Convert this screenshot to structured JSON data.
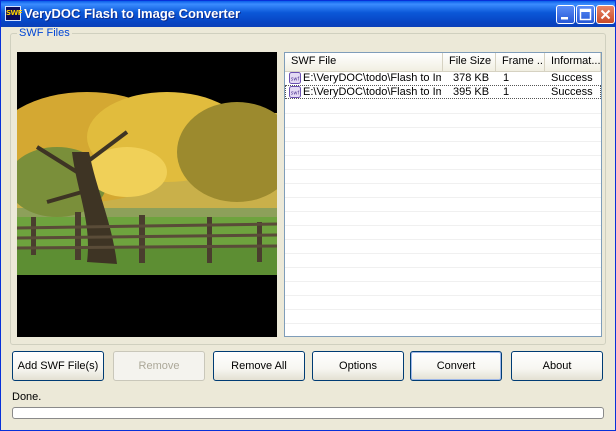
{
  "window": {
    "title": "VeryDOC Flash to Image Converter",
    "icon_text": "SWF",
    "icon": "swf-app-icon",
    "controls": [
      "minimize-icon",
      "maximize-icon",
      "close-icon"
    ]
  },
  "group": {
    "label": "SWF Files"
  },
  "preview": {
    "description_icon": "autumn-tree-image"
  },
  "list": {
    "columns": [
      "SWF File",
      "File Size",
      "Frame ...",
      "Informat..."
    ],
    "rows": [
      {
        "file": "E:\\VeryDOC\\todo\\Flash to Image ...",
        "size": "378 KB",
        "frame": "1",
        "info": "Success"
      },
      {
        "file": "E:\\VeryDOC\\todo\\Flash to Image ...",
        "size": "395 KB",
        "frame": "1",
        "info": "Success"
      }
    ],
    "row_icon": "swf-file-icon"
  },
  "buttons": {
    "add": "Add SWF File(s)",
    "remove": "Remove",
    "remove_all": "Remove All",
    "options": "Options",
    "convert": "Convert",
    "about": "About"
  },
  "status": {
    "text": "Done.",
    "progress": 0
  },
  "colors": {
    "titlebar": "#0A5FE8",
    "group_label": "#0046D5",
    "face": "#ECE9D8"
  }
}
